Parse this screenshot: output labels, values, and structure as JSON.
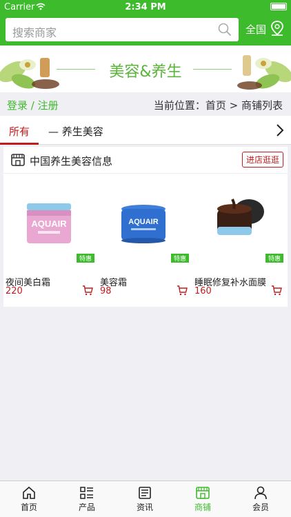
{
  "status": {
    "carrier": "Carrier",
    "time": "2:34 PM"
  },
  "header": {
    "search_placeholder": "搜索商家",
    "region": "全国"
  },
  "banner": {
    "title": "美容&养生"
  },
  "locbar": {
    "login": "登录 / 注册",
    "location": "当前位置：首页 > 商铺列表"
  },
  "tabs": {
    "all": "所有",
    "beauty": "— 养生美容"
  },
  "shop": {
    "title": "中国养生美容信息",
    "enter": "进店逛逛"
  },
  "products": [
    {
      "name": "夜间美白霜",
      "price": "220",
      "tag": "特惠",
      "brand": "AQUAIR"
    },
    {
      "name": "美容霜",
      "price": "98",
      "tag": "特惠",
      "brand": "AQUAIR"
    },
    {
      "name": "睡眠修复补水面膜",
      "price": "160",
      "tag": "特惠"
    }
  ],
  "tabbar": [
    {
      "label": "首页",
      "icon": "home-icon"
    },
    {
      "label": "产品",
      "icon": "list-icon"
    },
    {
      "label": "资讯",
      "icon": "news-icon"
    },
    {
      "label": "商铺",
      "icon": "store-icon",
      "active": true
    },
    {
      "label": "会员",
      "icon": "user-icon"
    }
  ],
  "colors": {
    "brand": "#3dbb2c",
    "accent": "#c21b1b"
  }
}
